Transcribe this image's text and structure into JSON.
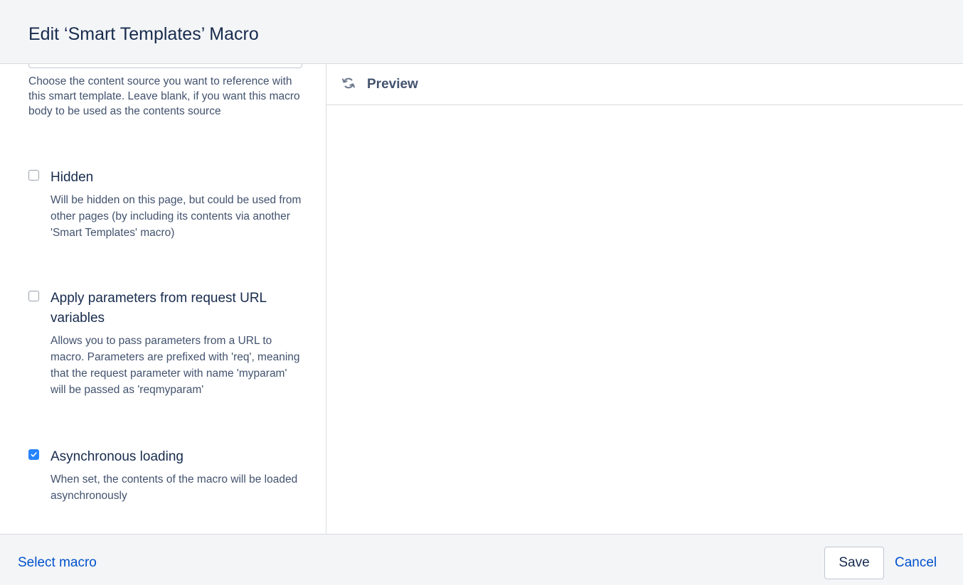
{
  "dialog": {
    "title": "Edit ‘Smart Templates’ Macro"
  },
  "left": {
    "content_source_description": "Choose the content source you want to reference with this smart template. Leave blank, if you want this macro body to be used as the contents source",
    "options": [
      {
        "label": "Hidden",
        "checked": false,
        "description": "Will be hidden on this page, but could be used from other pages (by including its contents via another 'Smart Templates' macro)"
      },
      {
        "label": "Apply parameters from request URL variables",
        "checked": false,
        "description": "Allows you to pass parameters from a URL to macro. Parameters are prefixed with 'req', meaning that the request parameter with name 'myparam' will be passed as 'reqmyparam'"
      },
      {
        "label": "Asynchronous loading",
        "checked": true,
        "description": "When set, the contents of the macro will be loaded asynchronously"
      }
    ]
  },
  "preview": {
    "label": "Preview",
    "icon": "refresh-icon"
  },
  "footer": {
    "select_macro_label": "Select macro",
    "save_label": "Save",
    "cancel_label": "Cancel"
  },
  "colors": {
    "link": "#0052cc",
    "checkbox_checked": "#2684ff",
    "header_bg": "#f4f5f7"
  }
}
